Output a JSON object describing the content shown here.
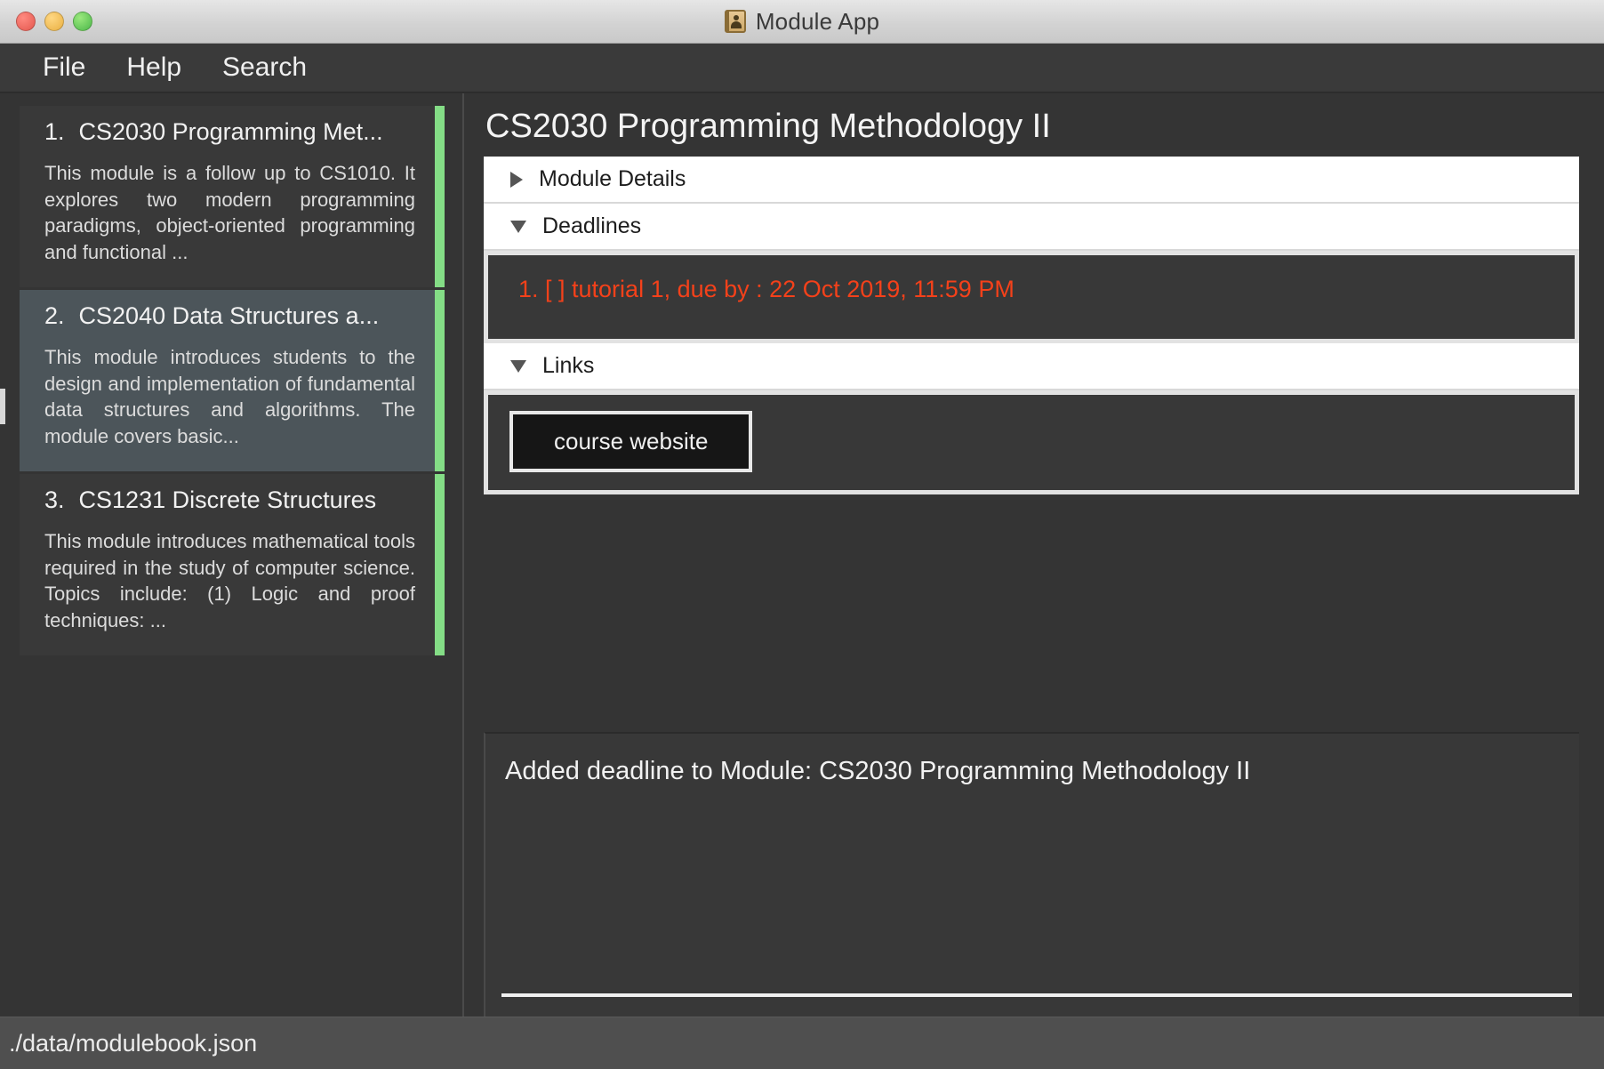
{
  "window": {
    "title": "Module App",
    "icon": "address-book-icon",
    "traffic_lights": [
      "close",
      "minimize",
      "maximize"
    ]
  },
  "menubar": {
    "items": [
      {
        "label": "File"
      },
      {
        "label": "Help"
      },
      {
        "label": "Search"
      }
    ]
  },
  "module_list": {
    "items": [
      {
        "number": "1.",
        "title": "CS2030 Programming Met...",
        "description": "This module is a follow up to CS1010. It explores two modern programming paradigms, object-oriented programming and functional ...",
        "selected": false,
        "accent_color": "#84dd86"
      },
      {
        "number": "2.",
        "title": "CS2040 Data Structures a...",
        "description": "This module introduces students to the design and implementation of fundamental data structures and algorithms. The module covers basic...",
        "selected": true,
        "accent_color": "#84dd86"
      },
      {
        "number": "3.",
        "title": "CS1231 Discrete Structures",
        "description": "This module introduces mathematical tools required in the study of computer science. Topics include: (1) Logic and proof techniques: ...",
        "selected": false,
        "accent_color": "#84dd86"
      }
    ]
  },
  "detail": {
    "title": "CS2030 Programming Methodology II",
    "sections": {
      "module_details": {
        "label": "Module Details",
        "expanded": false
      },
      "deadlines": {
        "label": "Deadlines",
        "expanded": true,
        "items": [
          {
            "text": "1. [ ] tutorial 1, due by : 22 Oct 2019, 11:59 PM",
            "color": "#f4411a"
          }
        ]
      },
      "links": {
        "label": "Links",
        "expanded": true,
        "buttons": [
          {
            "label": "course website"
          }
        ]
      }
    }
  },
  "result": {
    "message": "Added deadline to Module: CS2030 Programming Methodology II"
  },
  "statusbar": {
    "path": "./data/modulebook.json"
  },
  "colors": {
    "window_background": "#343434",
    "panel_background": "#383838",
    "accent_green": "#84dd86",
    "deadline_red": "#f4411a",
    "selected_card": "#4c555a",
    "accordion_header": "#ffffff"
  }
}
